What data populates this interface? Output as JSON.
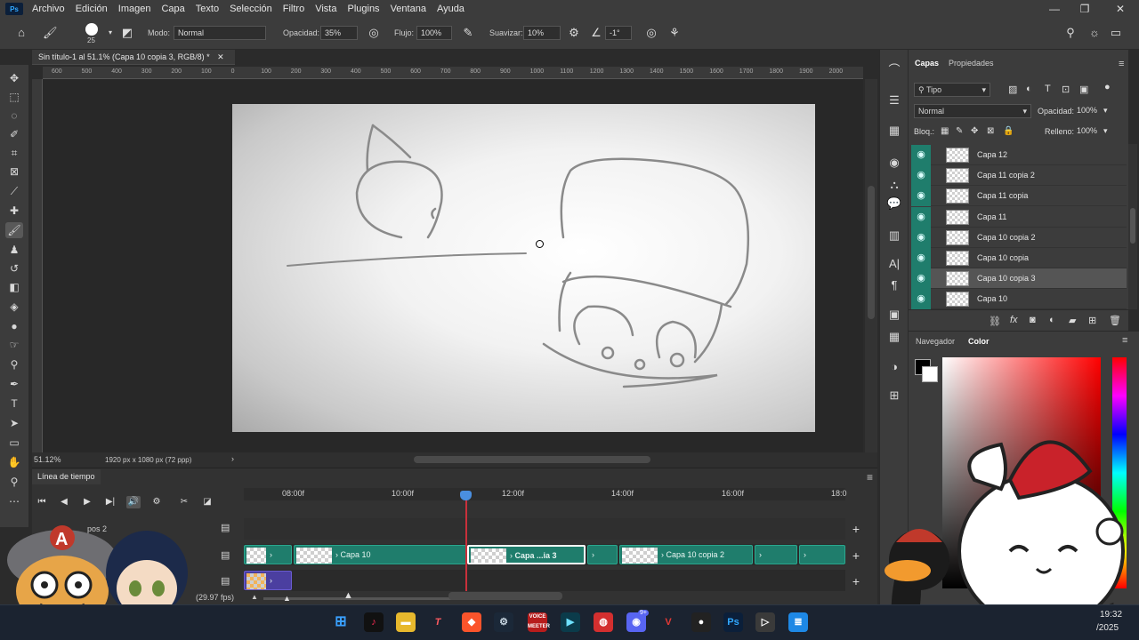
{
  "menubar": {
    "logo": "Ps",
    "items": [
      "Archivo",
      "Edición",
      "Imagen",
      "Capa",
      "Texto",
      "Selección",
      "Filtro",
      "Vista",
      "Plugins",
      "Ventana",
      "Ayuda"
    ]
  },
  "options": {
    "brush_size": "25",
    "mode_label": "Modo:",
    "mode_value": "Normal",
    "opacity_label": "Opacidad:",
    "opacity_value": "35%",
    "flow_label": "Flujo:",
    "flow_value": "100%",
    "smooth_label": "Suavizar:",
    "smooth_value": "10%",
    "angle_value": "-1°"
  },
  "document": {
    "tab_title": "Sin título-1 al 51.1% (Capa 10 copia 3, RGB/8) *",
    "zoom": "51.12%",
    "dimensions": "1920 px x 1080 px (72 ppp)"
  },
  "ruler": {
    "ticks": [
      "600",
      "500",
      "400",
      "300",
      "200",
      "100",
      "0",
      "100",
      "200",
      "300",
      "400",
      "500",
      "600",
      "700",
      "800",
      "900",
      "1000",
      "1100",
      "1200",
      "1300",
      "1400",
      "1500",
      "1600",
      "1700",
      "1800",
      "1900",
      "2000"
    ]
  },
  "timeline": {
    "title": "Línea de tiempo",
    "times": [
      "08:00f",
      "10:00f",
      "12:00f",
      "14:00f",
      "16:00f",
      "18:0"
    ],
    "group_label": "pos 2",
    "fps": "(29.97 fps)",
    "clips": [
      "Capa 10",
      "Capa ...ia 3",
      "Capa 10 copia 2"
    ]
  },
  "layers_panel": {
    "tabs": [
      "Capas",
      "Propiedades"
    ],
    "filter": "Tipo",
    "blend_mode": "Normal",
    "opacity_label": "Opacidad:",
    "opacity_value": "100%",
    "lock_label": "Bloq.:",
    "fill_label": "Relleno:",
    "fill_value": "100%",
    "layers": [
      {
        "name": "Capa 12",
        "selected": false
      },
      {
        "name": "Capa 11 copia 2",
        "selected": false
      },
      {
        "name": "Capa 11 copia",
        "selected": false
      },
      {
        "name": "Capa 11",
        "selected": false
      },
      {
        "name": "Capa 10 copia 2",
        "selected": false
      },
      {
        "name": "Capa 10 copia",
        "selected": false
      },
      {
        "name": "Capa 10 copia 3",
        "selected": true
      },
      {
        "name": "Capa 10",
        "selected": false
      }
    ]
  },
  "color_panel": {
    "tabs": [
      "Navegador",
      "Color"
    ],
    "foreground": "#000000",
    "background": "#ffffff"
  },
  "taskbar": {
    "time": "19:32",
    "date": "/2025",
    "badge": "9+",
    "voice_label": "VOICE MEETER"
  },
  "colors": {
    "accent": "#1f7d6c",
    "playhead": "#c9303b"
  }
}
